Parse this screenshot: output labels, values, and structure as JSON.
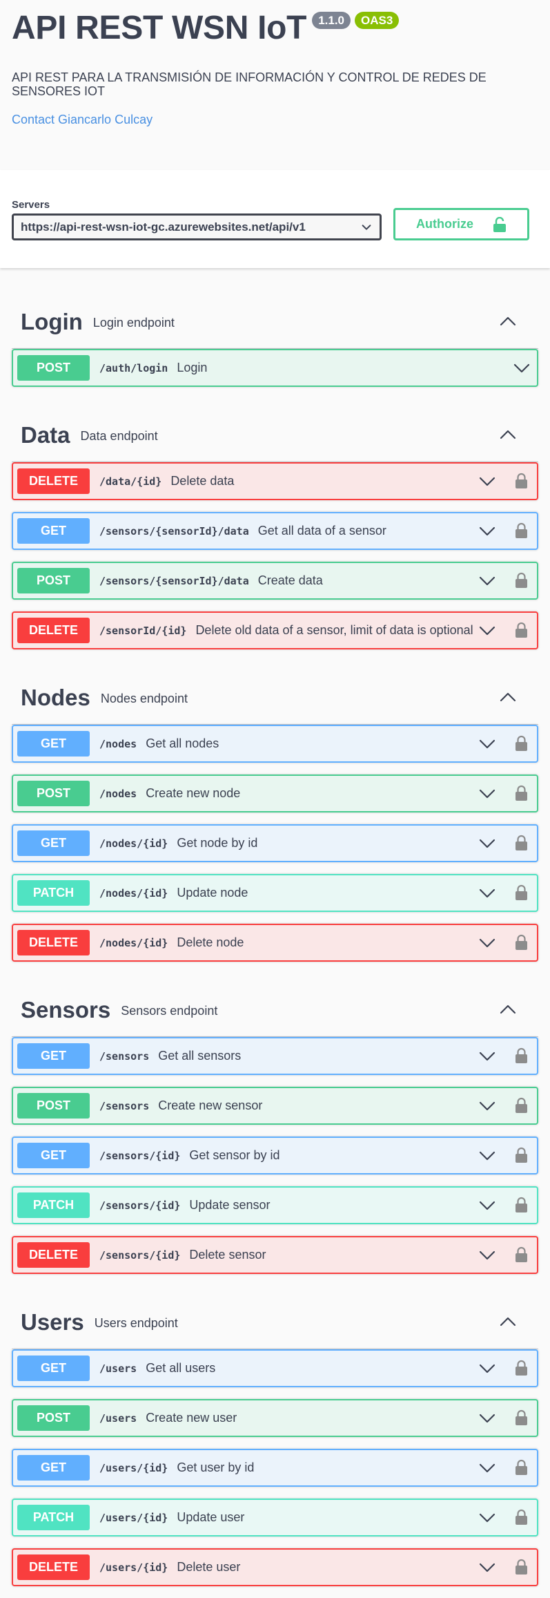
{
  "info": {
    "title": "API REST WSN IoT",
    "version": "1.1.0",
    "oas_badge": "OAS3",
    "description": "API REST PARA LA TRANSMISIÓN DE INFORMACIÓN Y CONTROL DE REDES DE SENSORES IOT",
    "contact": "Contact Giancarlo Culcay"
  },
  "servers": {
    "label": "Servers",
    "selected": "https://api-rest-wsn-iot-gc.azurewebsites.net/api/v1"
  },
  "authorize": {
    "label": "Authorize"
  },
  "colors": {
    "get": "#61affe",
    "post": "#49cc90",
    "delete": "#f93e3e",
    "patch": "#50e3c2",
    "text": "#3b4151",
    "link": "#4990e2"
  },
  "tags": [
    {
      "name": "Login",
      "description": "Login endpoint",
      "operations": [
        {
          "method": "POST",
          "path": "/auth/login",
          "summary": "Login",
          "locked": false
        }
      ]
    },
    {
      "name": "Data",
      "description": "Data endpoint",
      "operations": [
        {
          "method": "DELETE",
          "path": "/data/{id}",
          "summary": "Delete data",
          "locked": true
        },
        {
          "method": "GET",
          "path": "/sensors/{sensorId}/data",
          "summary": "Get all data of a sensor",
          "locked": true
        },
        {
          "method": "POST",
          "path": "/sensors/{sensorId}/data",
          "summary": "Create data",
          "locked": true
        },
        {
          "method": "DELETE",
          "path": "/sensorId/{id}",
          "summary": "Delete old data of a sensor, limit of data is optional",
          "locked": true
        }
      ]
    },
    {
      "name": "Nodes",
      "description": "Nodes endpoint",
      "operations": [
        {
          "method": "GET",
          "path": "/nodes",
          "summary": "Get all nodes",
          "locked": true
        },
        {
          "method": "POST",
          "path": "/nodes",
          "summary": "Create new node",
          "locked": true
        },
        {
          "method": "GET",
          "path": "/nodes/{id}",
          "summary": "Get node by id",
          "locked": true
        },
        {
          "method": "PATCH",
          "path": "/nodes/{id}",
          "summary": "Update node",
          "locked": true
        },
        {
          "method": "DELETE",
          "path": "/nodes/{id}",
          "summary": "Delete node",
          "locked": true
        }
      ]
    },
    {
      "name": "Sensors",
      "description": "Sensors endpoint",
      "operations": [
        {
          "method": "GET",
          "path": "/sensors",
          "summary": "Get all sensors",
          "locked": true
        },
        {
          "method": "POST",
          "path": "/sensors",
          "summary": "Create new sensor",
          "locked": true
        },
        {
          "method": "GET",
          "path": "/sensors/{id}",
          "summary": "Get sensor by id",
          "locked": true
        },
        {
          "method": "PATCH",
          "path": "/sensors/{id}",
          "summary": "Update sensor",
          "locked": true
        },
        {
          "method": "DELETE",
          "path": "/sensors/{id}",
          "summary": "Delete sensor",
          "locked": true
        }
      ]
    },
    {
      "name": "Users",
      "description": "Users endpoint",
      "operations": [
        {
          "method": "GET",
          "path": "/users",
          "summary": "Get all users",
          "locked": true
        },
        {
          "method": "POST",
          "path": "/users",
          "summary": "Create new user",
          "locked": true
        },
        {
          "method": "GET",
          "path": "/users/{id}",
          "summary": "Get user by id",
          "locked": true
        },
        {
          "method": "PATCH",
          "path": "/users/{id}",
          "summary": "Update user",
          "locked": true
        },
        {
          "method": "DELETE",
          "path": "/users/{id}",
          "summary": "Delete user",
          "locked": true
        }
      ]
    }
  ]
}
